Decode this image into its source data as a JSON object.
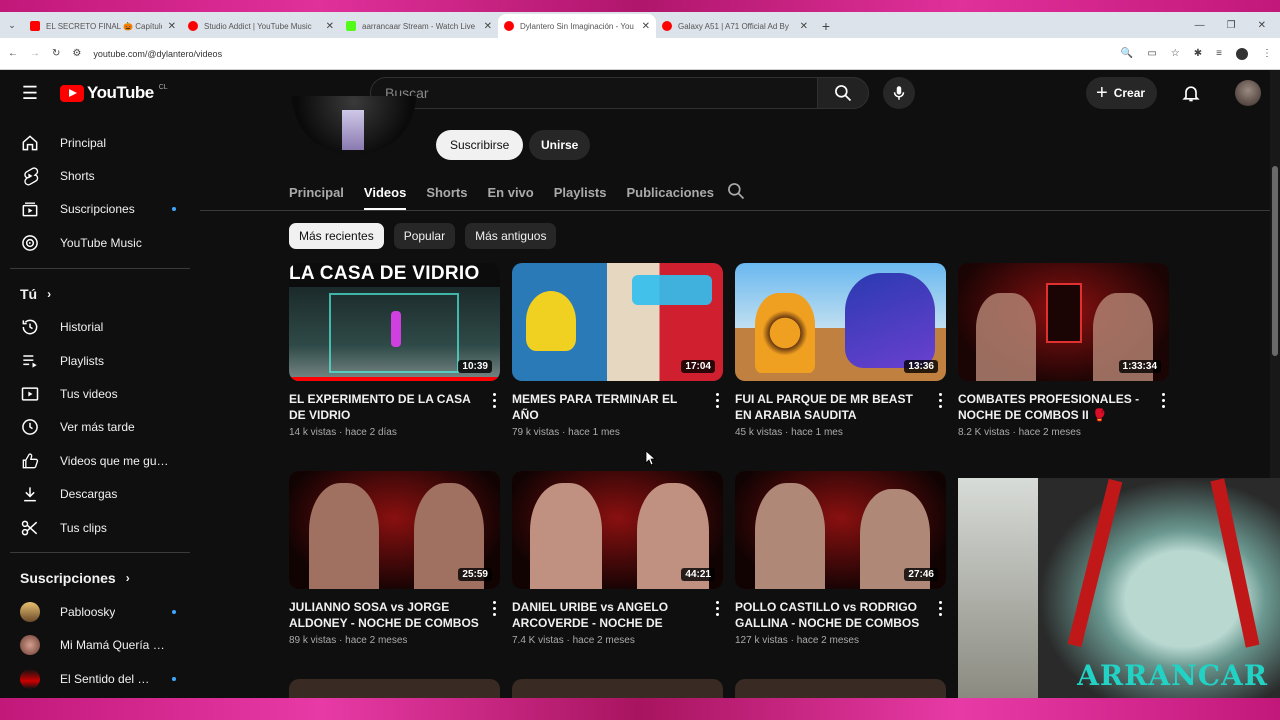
{
  "browser": {
    "tabs": [
      {
        "title": "EL SECRETO FINAL 🎃 Capítulo",
        "color": "#ff0000"
      },
      {
        "title": "Studio Addict | YouTube Music",
        "color": "#ff0000"
      },
      {
        "title": "aarrancaar Stream - Watch Live",
        "color": "#53fc18"
      },
      {
        "title": "Dylantero Sin Imaginación - You",
        "color": "#ff0000",
        "active": true
      },
      {
        "title": "Galaxy A51 | A71 Official Ad By",
        "color": "#ff0000"
      }
    ],
    "url": "youtube.com/@dylantero/videos"
  },
  "header": {
    "logo_text": "YouTube",
    "logo_country": "CL",
    "search_placeholder": "Buscar",
    "create_label": "Crear"
  },
  "sidebar": {
    "main": [
      {
        "label": "Principal",
        "icon": "home-icon"
      },
      {
        "label": "Shorts",
        "icon": "shorts-icon"
      },
      {
        "label": "Suscripciones",
        "icon": "subscriptions-icon",
        "dot": true
      },
      {
        "label": "YouTube Music",
        "icon": "music-icon"
      }
    ],
    "you_heading": "Tú",
    "you": [
      {
        "label": "Historial",
        "icon": "history-icon"
      },
      {
        "label": "Playlists",
        "icon": "playlists-icon"
      },
      {
        "label": "Tus videos",
        "icon": "your-videos-icon"
      },
      {
        "label": "Ver más tarde",
        "icon": "watch-later-icon"
      },
      {
        "label": "Videos que me gus...",
        "icon": "liked-icon"
      },
      {
        "label": "Descargas",
        "icon": "downloads-icon"
      },
      {
        "label": "Tus clips",
        "icon": "clips-icon"
      }
    ],
    "subs_heading": "Suscripciones",
    "subs": [
      {
        "label": "Pabloosky",
        "dot": true
      },
      {
        "label": "Mi Mamá Quería Q...",
        "dot": false
      },
      {
        "label": "El Sentido del Hu...",
        "dot": true
      }
    ]
  },
  "channel": {
    "subscribe_label": "Suscribirse",
    "join_label": "Unirse",
    "tabs": [
      "Principal",
      "Videos",
      "Shorts",
      "En vivo",
      "Playlists",
      "Publicaciones"
    ],
    "active_tab": "Videos",
    "chips": [
      "Más recientes",
      "Popular",
      "Más antiguos"
    ]
  },
  "videos": [
    {
      "title": "EL EXPERIMENTO DE LA CASA DE VIDRIO",
      "views": "14 k vistas",
      "age": "hace 2 días",
      "duration": "10:39",
      "thumb_text": "LA CASA DE VIDRIO"
    },
    {
      "title": "MEMES PARA TERMINAR EL AÑO",
      "views": "79 k vistas",
      "age": "hace 1 mes",
      "duration": "17:04"
    },
    {
      "title": "FUI AL PARQUE DE MR BEAST EN ARABIA SAUDITA",
      "views": "45 k vistas",
      "age": "hace 1 mes",
      "duration": "13:36"
    },
    {
      "title": "COMBATES PROFESIONALES - NOCHE DE COMBOS II 🥊",
      "views": "8.2 K vistas",
      "age": "hace 2 meses",
      "duration": "1:33:34"
    },
    {
      "title": "JULIANNO SOSA vs JORGE ALDONEY - NOCHE DE COMBOS II...",
      "views": "89 k vistas",
      "age": "hace 2 meses",
      "duration": "25:59"
    },
    {
      "title": "DANIEL URIBE vs ANGELO ARCOVERDE - NOCHE DE COMBO...",
      "views": "7.4 K vistas",
      "age": "hace 2 meses",
      "duration": "44:21"
    },
    {
      "title": "POLLO CASTILLO vs RODRIGO GALLINA - NOCHE DE COMBOS II...",
      "views": "127 k vistas",
      "age": "hace 2 meses",
      "duration": "27:46"
    }
  ],
  "overlay": {
    "watermark": "ARRANCAR"
  }
}
